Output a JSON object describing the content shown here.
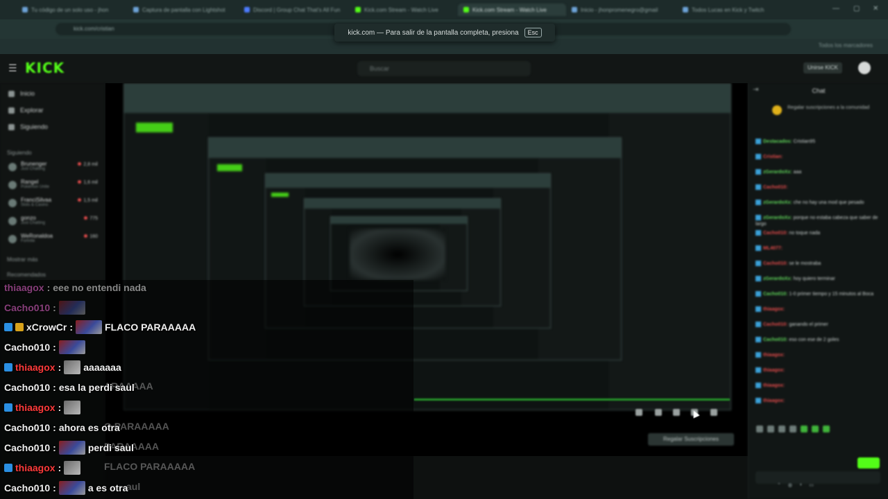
{
  "browser": {
    "tabs": [
      {
        "title": "Tu código de un solo uso - jhon",
        "active": false
      },
      {
        "title": "Captura de pantalla con Lightshot",
        "active": false
      },
      {
        "title": "Discord | Group Chat That's All Fun",
        "active": false
      },
      {
        "title": "Kick.com Stream - Watch Live",
        "active": false
      },
      {
        "title": "Kick.com Stream - Watch Live",
        "active": true
      },
      {
        "title": "Inicio - jhonpromenegro@gmail",
        "active": false
      },
      {
        "title": "Todos Lucas en Kick y Twitch",
        "active": false
      }
    ],
    "url": "kick.com/cristian",
    "fullscreen_toast": "kick.com — Para salir de la pantalla completa, presiona",
    "esc_key": "Esc",
    "bookmarks_right": "Todos los marcadores"
  },
  "kick": {
    "logo": "KICK",
    "search_placeholder": "Buscar",
    "upgrade_label": "Unirse KICK",
    "sidebar": {
      "nav": [
        "Inicio",
        "Explorar",
        "Siguiendo"
      ],
      "following_header": "Siguiendo",
      "following": [
        {
          "name": "Brunenger",
          "sub": "Just Chatting",
          "viewers": "2,8 mil"
        },
        {
          "name": "Rangel",
          "sub": "Pokémon Unite",
          "viewers": "1,6 mil"
        },
        {
          "name": "FranciSilvaa",
          "sub": "Slots & Casino",
          "viewers": "1,5 mil"
        },
        {
          "name": "gonzo",
          "sub": "Just Chatting",
          "viewers": "775"
        },
        {
          "name": "WeRonaldoa",
          "sub": "Fortnite",
          "viewers": "160"
        }
      ],
      "show_more": "Mostrar más",
      "recommended_header": "Recomendados"
    },
    "player": {
      "subscribe_button": "Regalar Suscripciones"
    },
    "chat": {
      "title": "Chat",
      "pinned": "Regalar suscripciones a la comunidad",
      "messages": [
        {
          "user": "Destacados",
          "text": "Cristian95",
          "color": "green"
        },
        {
          "user": "Cristian",
          "text": "",
          "color": "red"
        },
        {
          "user": "zGerardoXx",
          "text": "aaa",
          "color": "green"
        },
        {
          "user": "Cacho010",
          "text": "",
          "color": "red"
        },
        {
          "user": "zGerardoXx",
          "text": "che no hay una mod que pesado",
          "color": "green"
        },
        {
          "user": "zGerardoXx",
          "text": "porque no estaba cabeza que saber de largo",
          "color": "green"
        },
        {
          "user": "Cacho010",
          "text": "no toque nada",
          "color": "red"
        },
        {
          "user": "ML4077",
          "text": "",
          "color": "red"
        },
        {
          "user": "Cacho010",
          "text": "se le mostraba",
          "color": "red"
        },
        {
          "user": "zGerardoXx",
          "text": "hoy quiero terminar",
          "color": "green"
        },
        {
          "user": "Cacho010",
          "text": "1-0 primer tiempo y 15 minutos al Boca",
          "color": "green"
        },
        {
          "user": "thiaagox",
          "text": "",
          "color": "red"
        },
        {
          "user": "Cacho010",
          "text": "ganando el primer",
          "color": "red"
        },
        {
          "user": "Cacho010",
          "text": "eso con ese de 2 goles",
          "color": "green"
        },
        {
          "user": "thiaagox",
          "text": "",
          "color": "red"
        },
        {
          "user": "thiaagox",
          "text": "",
          "color": "red"
        },
        {
          "user": "thiaagox",
          "text": "",
          "color": "red"
        },
        {
          "user": "thiaagox",
          "text": "",
          "color": "red"
        }
      ]
    }
  },
  "overlay_chat": [
    {
      "user": "thiaagox",
      "separator": ":",
      "text": "eee no entendi nada",
      "color": "pink",
      "faded": true,
      "thumb": false
    },
    {
      "user": "Cacho010",
      "separator": ":",
      "text": "",
      "color": "pink",
      "faded": true,
      "thumb": true
    },
    {
      "user": "xCrowCr",
      "separator": ":",
      "text": "FLACO PARAAAAA",
      "color": "white",
      "faded": false,
      "thumb": true,
      "badges": [
        "kick",
        "gold"
      ]
    },
    {
      "user": "Cacho010",
      "separator": ":",
      "text": "",
      "color": "white",
      "faded": false,
      "thumb": true
    },
    {
      "user": "thiaagox",
      "separator": ":",
      "text": "aaaaaaa",
      "color": "red",
      "faded": false,
      "thumb": true,
      "badges": [
        "kick"
      ]
    },
    {
      "user": "Cacho010",
      "separator": ":",
      "text": "esa la perdi saul",
      "color": "white",
      "faded": false,
      "thumb": false
    },
    {
      "user": "thiaagox",
      "separator": ":",
      "text": "",
      "color": "red",
      "faded": false,
      "thumb": true,
      "badges": [
        "kick"
      ]
    },
    {
      "user": "Cacho010",
      "separator": ":",
      "text": "ahora es otra",
      "color": "white",
      "faded": false,
      "thumb": false
    },
    {
      "user": "Cacho010",
      "separator": ":",
      "text": "perdi saul",
      "color": "white",
      "faded": false,
      "thumb": true
    },
    {
      "user": "thiaagox",
      "separator": ":",
      "text": "",
      "color": "red",
      "faded": false,
      "thumb": true,
      "badges": [
        "kick"
      ]
    },
    {
      "user": "Cacho010",
      "separator": ":",
      "text": "a es otra",
      "color": "white",
      "faded": false,
      "thumb": true
    }
  ],
  "overlay_ghosts": [
    "ARAAAAA",
    "O PARAAAAA",
    "PARAAAAA",
    "FLACO PARAAAAA",
    "aul"
  ],
  "colors": {
    "kick_green": "#53fc18",
    "badge_blue": "#2a8fe3",
    "name_red": "#ff3b3b"
  }
}
